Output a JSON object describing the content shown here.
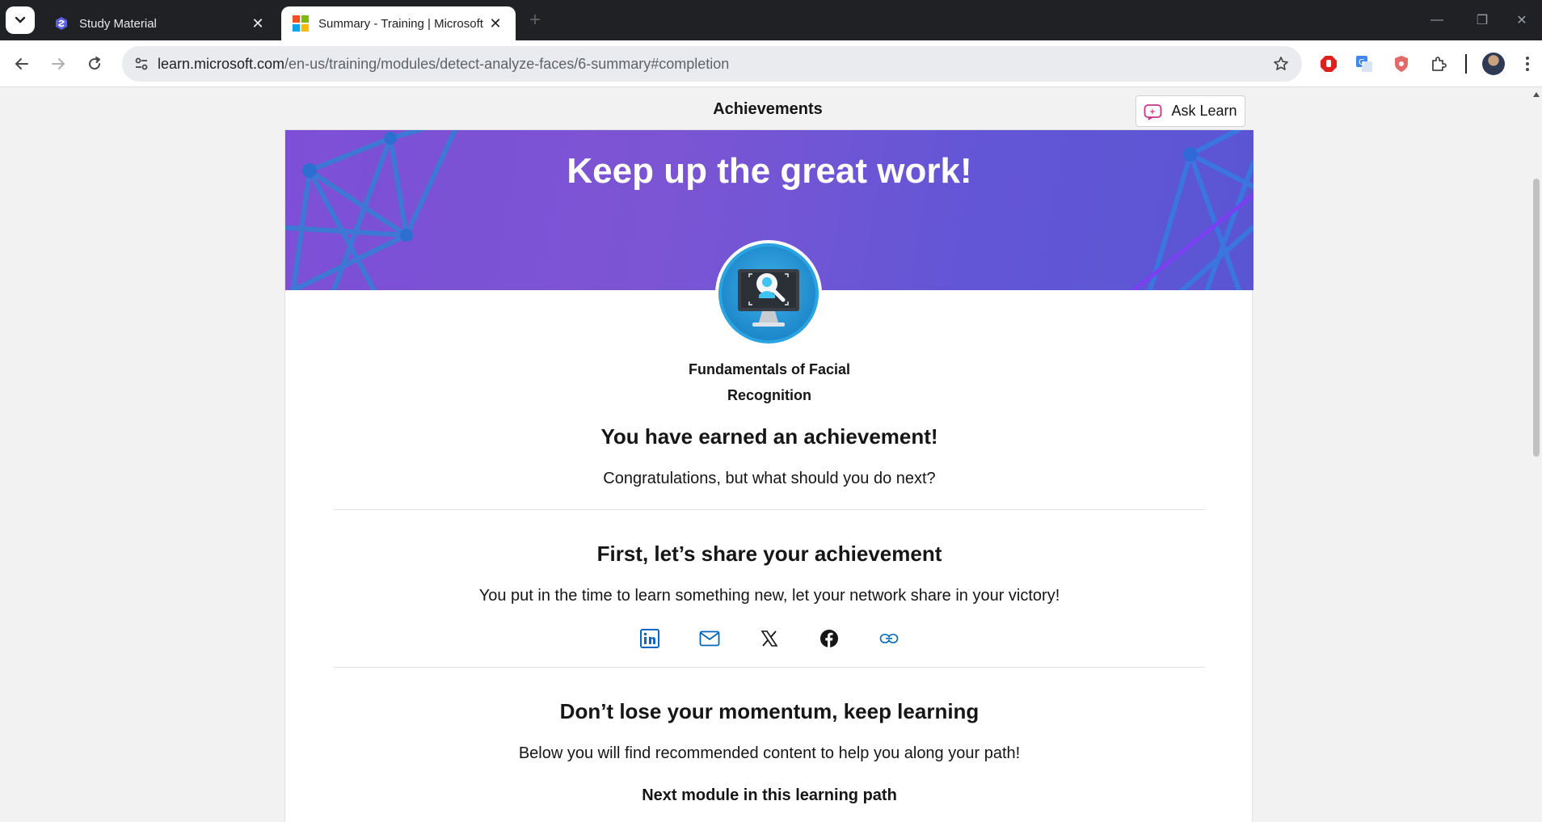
{
  "browser": {
    "tabs": [
      {
        "title": "Study Material",
        "active": false,
        "icon": "study-material-favicon"
      },
      {
        "title": "Summary - Training | Microsoft",
        "active": true,
        "icon": "microsoft-favicon"
      }
    ],
    "url_host": "learn.microsoft.com",
    "url_path": "/en-us/training/modules/detect-analyze-faces/6-summary#completion"
  },
  "page": {
    "section_title": "Achievements",
    "ask_learn_label": "Ask Learn",
    "hero_title": "Keep up the great work!",
    "module_name_line1": "Fundamentals of Facial",
    "module_name_line2": "Recognition",
    "earned_heading": "You have earned an achievement!",
    "earned_sub": "Congratulations, but what should you do next?",
    "share_heading": "First, let’s share your achievement",
    "share_sub": "You put in the time to learn something new, let your network share in your victory!",
    "share_targets": [
      "linkedin-icon",
      "email-icon",
      "x-icon",
      "facebook-icon",
      "copy-link-icon"
    ],
    "momentum_heading": "Don’t lose your momentum, keep learning",
    "momentum_sub": "Below you will find recommended content to help you along your path!",
    "next_module_heading": "Next module in this learning path"
  },
  "colors": {
    "hero_start": "#7d4fd6",
    "hero_end": "#5a55d3",
    "linkedin": "#0a66c2",
    "link_accent": "#0067b8"
  }
}
